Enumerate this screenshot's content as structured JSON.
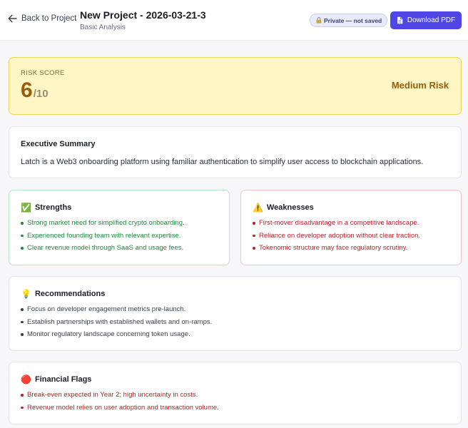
{
  "header": {
    "back_label": "Back to Project",
    "title": "New Project - 2026-03-21-3",
    "subtitle": "Basic Analysis",
    "badge": "Private — not saved",
    "download_label": "Download PDF"
  },
  "risk": {
    "label": "RISK SCORE",
    "score": "6",
    "out_of": "/10",
    "level": "Medium Risk"
  },
  "summary": {
    "title": "Executive Summary",
    "text": "Latch is a Web3 onboarding platform using familiar authentication to simplify user access to blockchain applications."
  },
  "strengths": {
    "emoji": "✅",
    "title": "Strengths",
    "items": [
      "Strong market need for simplified crypto onboarding.",
      "Experienced founding team with relevant expertise.",
      "Clear revenue model through SaaS and usage fees."
    ]
  },
  "weaknesses": {
    "emoji": "⚠️",
    "title": "Weaknesses",
    "items": [
      "First-mover disadvantage in a competitive landscape.",
      "Reliance on developer adoption without clear traction.",
      "Tokenomic structure may face regulatory scrutiny."
    ]
  },
  "recommendations": {
    "emoji": "💡",
    "title": "Recommendations",
    "items": [
      "Focus on developer engagement metrics pre-launch.",
      "Establish partnerships with established wallets and on-ramps.",
      "Monitor regulatory landscape concerning token usage."
    ]
  },
  "financial": {
    "emoji": "🔴",
    "title": "Financial Flags",
    "items": [
      "Break-even expected in Year 2; high uncertainty in costs.",
      "Revenue model relies on user adoption and transaction volume."
    ]
  },
  "colors": {
    "accent": "#4f46e5",
    "risk_bg": "#fef6c4",
    "risk_text": "#9a5b0b",
    "strength": "#1e8a3c",
    "weakness": "#b8232a"
  }
}
